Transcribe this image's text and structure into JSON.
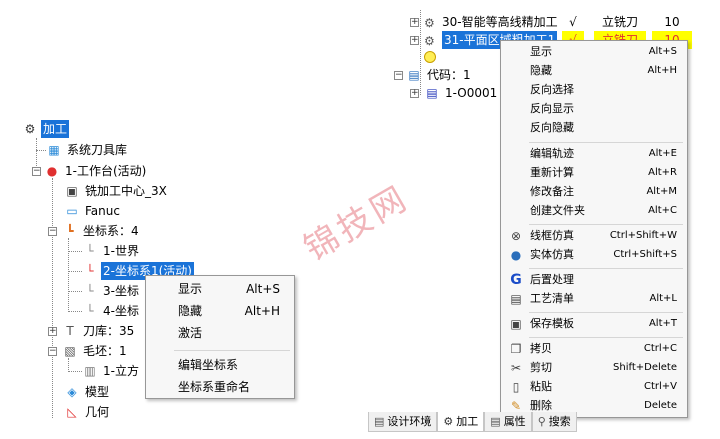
{
  "tree": {
    "root_label": "加工",
    "system_tools": "系统刀具库",
    "workbench": "1-工作台(活动)",
    "machine": "铣加工中心_3X",
    "controller": "Fanuc",
    "coord_group": "坐标系：4",
    "coord_1": "1-世界",
    "coord_2": "2-坐标系1(活动)",
    "coord_3": "3-坐标",
    "coord_4": "4-坐标",
    "tool_lib": "刀库：35",
    "stock_group": "毛坯：1",
    "stock_1": "1-立方",
    "model": "模型",
    "geometry": "几何"
  },
  "top_table": {
    "row1": {
      "name": "30-智能等高线精加工",
      "check": "√",
      "tool": "立铣刀",
      "num": "10"
    },
    "row2": {
      "name": "31-平面区域粗加工1",
      "check": "√",
      "tool": "立铣刀",
      "num": "10"
    },
    "code_group": "代码：1",
    "code_1": "1-O0001"
  },
  "small_menu": {
    "items": [
      {
        "label": "显示",
        "shortcut": "Alt+S"
      },
      {
        "label": "隐藏",
        "shortcut": "Alt+H"
      },
      {
        "label": "激活",
        "shortcut": ""
      },
      {
        "label": "编辑坐标系",
        "shortcut": ""
      },
      {
        "label": "坐标系重命名",
        "shortcut": ""
      }
    ]
  },
  "big_menu": {
    "items": [
      {
        "label": "显示",
        "shortcut": "Alt+S",
        "icon": ""
      },
      {
        "label": "隐藏",
        "shortcut": "Alt+H",
        "icon": ""
      },
      {
        "label": "反向选择",
        "shortcut": "",
        "icon": ""
      },
      {
        "label": "反向显示",
        "shortcut": "",
        "icon": ""
      },
      {
        "label": "反向隐藏",
        "shortcut": "",
        "icon": ""
      },
      {
        "label": "编辑轨迹",
        "shortcut": "Alt+E",
        "icon": ""
      },
      {
        "label": "重新计算",
        "shortcut": "Alt+R",
        "icon": ""
      },
      {
        "label": "修改备注",
        "shortcut": "Alt+M",
        "icon": ""
      },
      {
        "label": "创建文件夹",
        "shortcut": "Alt+C",
        "icon": ""
      },
      {
        "label": "线框仿真",
        "shortcut": "Ctrl+Shift+W",
        "icon": "wireframe-sim-icon"
      },
      {
        "label": "实体仿真",
        "shortcut": "Ctrl+Shift+S",
        "icon": "solid-sim-icon"
      },
      {
        "label": "后置处理",
        "shortcut": "",
        "icon": "post-process-icon"
      },
      {
        "label": "工艺清单",
        "shortcut": "Alt+L",
        "icon": "process-list-icon"
      },
      {
        "label": "保存模板",
        "shortcut": "Alt+T",
        "icon": "save-template-icon"
      },
      {
        "label": "拷贝",
        "shortcut": "Ctrl+C",
        "icon": "copy-icon"
      },
      {
        "label": "剪切",
        "shortcut": "Shift+Delete",
        "icon": "cut-icon"
      },
      {
        "label": "粘贴",
        "shortcut": "Ctrl+V",
        "icon": "paste-icon"
      },
      {
        "label": "删除",
        "shortcut": "Delete",
        "icon": "delete-icon"
      }
    ]
  },
  "tabs": [
    "设计环境",
    "加工",
    "属性",
    "搜索"
  ],
  "watermark": "锦技网",
  "colors": {
    "selection": "#1a73d8",
    "highlight_row": "#ffff00",
    "accent_red": "#e03030"
  }
}
